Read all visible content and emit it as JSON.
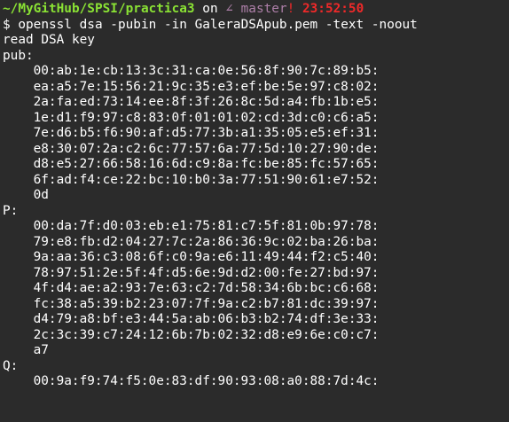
{
  "prompt": {
    "path": "~/MyGitHub/SPSI/practica3",
    "on_word": "on",
    "branch_icon": "∠",
    "branch": "master",
    "dirty_marker": "!",
    "time": "23:52:50"
  },
  "command": "$ openssl dsa -pubin -in GaleraDSApub.pem -text -noout",
  "output": {
    "read_msg": "read DSA key",
    "pub_label": "pub:",
    "pub_lines": [
      "00:ab:1e:cb:13:3c:31:ca:0e:56:8f:90:7c:89:b5:",
      "ea:a5:7e:15:56:21:9c:35:e3:ef:be:5e:97:c8:02:",
      "2a:fa:ed:73:14:ee:8f:3f:26:8c:5d:a4:fb:1b:e5:",
      "1e:d1:f9:97:c8:83:0f:01:01:02:cd:3d:c0:c6:a5:",
      "7e:d6:b5:f6:90:af:d5:77:3b:a1:35:05:e5:ef:31:",
      "e8:30:07:2a:c2:6c:77:57:6a:77:5d:10:27:90:de:",
      "d8:e5:27:66:58:16:6d:c9:8a:fc:be:85:fc:57:65:",
      "6f:ad:f4:ce:22:bc:10:b0:3a:77:51:90:61:e7:52:",
      "0d"
    ],
    "p_label": "P:",
    "p_lines": [
      "00:da:7f:d0:03:eb:e1:75:81:c7:5f:81:0b:97:78:",
      "79:e8:fb:d2:04:27:7c:2a:86:36:9c:02:ba:26:ba:",
      "9a:aa:36:c3:08:6f:c0:9a:e6:11:49:44:f2:c5:40:",
      "78:97:51:2e:5f:4f:d5:6e:9d:d2:00:fe:27:bd:97:",
      "4f:d4:ae:a2:93:7e:63:c2:7d:58:34:6b:bc:c6:68:",
      "fc:38:a5:39:b2:23:07:7f:9a:c2:b7:81:dc:39:97:",
      "d4:79:a8:bf:e3:44:5a:ab:06:b3:b2:74:df:3e:33:",
      "2c:3c:39:c7:24:12:6b:7b:02:32:d8:e9:6e:c0:c7:",
      "a7"
    ],
    "q_label": "Q:",
    "q_lines": [
      "00:9a:f9:74:f5:0e:83:df:90:93:08:a0:88:7d:4c:"
    ]
  },
  "colors": {
    "background": "#2b2b2b",
    "path": "#8ae234",
    "branch": "#ad7fa8",
    "time": "#ef2929"
  }
}
